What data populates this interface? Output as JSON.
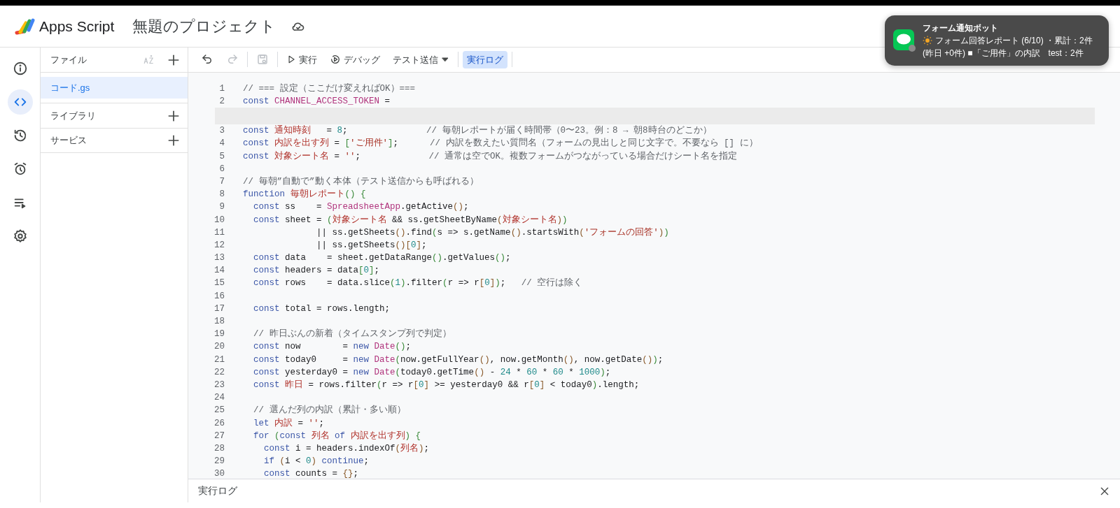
{
  "header": {
    "app_name": "Apps Script",
    "project_title": "無題のプロジェクト"
  },
  "rail": [
    {
      "kind": "info",
      "selected": false
    },
    {
      "kind": "code",
      "selected": true
    },
    {
      "kind": "history",
      "selected": false
    },
    {
      "kind": "alarm",
      "selected": false
    },
    {
      "kind": "executions",
      "selected": false
    },
    {
      "kind": "settings",
      "selected": false
    }
  ],
  "files_panel": {
    "title": "ファイル",
    "files": [
      {
        "name": "コード.gs",
        "selected": true
      }
    ],
    "sections": [
      {
        "title": "ライブラリ"
      },
      {
        "title": "サービス"
      }
    ]
  },
  "toolbar": {
    "undo": {
      "disabled": false
    },
    "redo": {
      "disabled": true
    },
    "save": {
      "disabled": true
    },
    "run": "実行",
    "debug": "デバッグ",
    "test_send": "テスト送信",
    "log_toggle": {
      "label": "実行ログ",
      "selected": true
    }
  },
  "editor": {
    "lines": [
      {
        "n": "1",
        "tokens": [
          {
            "kind": "comment",
            "text": "// === 設定（ここだけ変えればOK）==="
          }
        ]
      },
      {
        "n": "2",
        "redacted": true,
        "tokens": [
          {
            "kind": "keyword",
            "text": "const "
          },
          {
            "kind": "member",
            "text": "CHANNEL_ACCESS_TOKEN"
          },
          {
            "kind": "plain",
            "text": " ="
          }
        ]
      },
      {
        "n": "3",
        "tokens": [
          {
            "kind": "keyword",
            "text": "const "
          },
          {
            "kind": "variable",
            "text": "通知時刻"
          },
          {
            "kind": "plain",
            "text": "   = "
          },
          {
            "kind": "number",
            "text": "8"
          },
          {
            "kind": "plain",
            "text": ";"
          },
          {
            "kind": "comment",
            "text": "               // 毎朝レポートが届く時間帯（0〜23。例：8 → 朝8時台のどこか）"
          }
        ]
      },
      {
        "n": "4",
        "tokens": [
          {
            "kind": "keyword",
            "text": "const "
          },
          {
            "kind": "variable",
            "text": "内訳を出す列"
          },
          {
            "kind": "plain",
            "text": " = "
          },
          {
            "kind": "bracket",
            "text": "["
          },
          {
            "kind": "string",
            "text": "'ご用件'"
          },
          {
            "kind": "bracket",
            "text": "]"
          },
          {
            "kind": "plain",
            "text": ";"
          },
          {
            "kind": "comment",
            "text": "      // 内訳を数えたい質問名（フォームの見出しと同じ文字で。不要なら [] に）"
          }
        ]
      },
      {
        "n": "5",
        "tokens": [
          {
            "kind": "keyword",
            "text": "const "
          },
          {
            "kind": "variable",
            "text": "対象シート名"
          },
          {
            "kind": "plain",
            "text": " = "
          },
          {
            "kind": "string",
            "text": "''"
          },
          {
            "kind": "plain",
            "text": ";"
          },
          {
            "kind": "comment",
            "text": "             // 通常は空でOK。複数フォームがつながっている場合だけシート名を指定"
          }
        ]
      },
      {
        "n": "6"
      },
      {
        "n": "7",
        "tokens": [
          {
            "kind": "comment",
            "text": "// 毎朝”自動で”動く本体（テスト送信からも呼ばれる）"
          }
        ]
      },
      {
        "n": "8",
        "tokens": [
          {
            "kind": "keyword",
            "text": "function "
          },
          {
            "kind": "variable",
            "text": "毎朝レポート"
          },
          {
            "kind": "bracket",
            "text": "()"
          },
          {
            "kind": "bracket",
            "text": " {"
          }
        ]
      },
      {
        "n": "9",
        "tokens": [
          {
            "kind": "keyword",
            "text": "  const"
          },
          {
            "kind": "plain",
            "text": " ss    = "
          },
          {
            "kind": "member",
            "text": "SpreadsheetApp"
          },
          {
            "kind": "plain",
            "text": ".getActive"
          },
          {
            "kind": "paren",
            "text": "()"
          },
          {
            "kind": "plain",
            "text": ";"
          }
        ]
      },
      {
        "n": "10",
        "tokens": [
          {
            "kind": "keyword",
            "text": "  const"
          },
          {
            "kind": "plain",
            "text": " sheet = "
          },
          {
            "kind": "bracket",
            "text": "("
          },
          {
            "kind": "variable",
            "text": "対象シート名"
          },
          {
            "kind": "plain",
            "text": " && ss.getSheetByName"
          },
          {
            "kind": "paren",
            "text": "("
          },
          {
            "kind": "variable",
            "text": "対象シート名"
          },
          {
            "kind": "paren",
            "text": ")"
          },
          {
            "kind": "bracket",
            "text": ")"
          }
        ]
      },
      {
        "n": "11",
        "tokens": [
          {
            "kind": "plain",
            "text": "              || ss.getSheets"
          },
          {
            "kind": "paren",
            "text": "()"
          },
          {
            "kind": "plain",
            "text": ".find"
          },
          {
            "kind": "bracket",
            "text": "("
          },
          {
            "kind": "plain",
            "text": "s => s.getName"
          },
          {
            "kind": "paren",
            "text": "()"
          },
          {
            "kind": "plain",
            "text": ".startsWith"
          },
          {
            "kind": "paren",
            "text": "("
          },
          {
            "kind": "string",
            "text": "'フォームの回答'"
          },
          {
            "kind": "paren",
            "text": ")"
          },
          {
            "kind": "bracket",
            "text": ")"
          }
        ]
      },
      {
        "n": "12",
        "tokens": [
          {
            "kind": "plain",
            "text": "              || ss.getSheets"
          },
          {
            "kind": "paren",
            "text": "()"
          },
          {
            "kind": "paren",
            "text": "["
          },
          {
            "kind": "number",
            "text": "0"
          },
          {
            "kind": "paren",
            "text": "]"
          },
          {
            "kind": "plain",
            "text": ";"
          }
        ]
      },
      {
        "n": "13",
        "tokens": [
          {
            "kind": "keyword",
            "text": "  const"
          },
          {
            "kind": "plain",
            "text": " data    = sheet.getDataRange"
          },
          {
            "kind": "bracket",
            "text": "()"
          },
          {
            "kind": "plain",
            "text": ".getValues"
          },
          {
            "kind": "bracket",
            "text": "()"
          },
          {
            "kind": "plain",
            "text": ";"
          }
        ]
      },
      {
        "n": "14",
        "tokens": [
          {
            "kind": "keyword",
            "text": "  const"
          },
          {
            "kind": "plain",
            "text": " headers = data"
          },
          {
            "kind": "bracket",
            "text": "["
          },
          {
            "kind": "number",
            "text": "0"
          },
          {
            "kind": "bracket",
            "text": "]"
          },
          {
            "kind": "plain",
            "text": ";"
          }
        ]
      },
      {
        "n": "15",
        "tokens": [
          {
            "kind": "keyword",
            "text": "  const"
          },
          {
            "kind": "plain",
            "text": " rows    = data.slice"
          },
          {
            "kind": "bracket",
            "text": "("
          },
          {
            "kind": "number",
            "text": "1"
          },
          {
            "kind": "bracket",
            "text": ")"
          },
          {
            "kind": "plain",
            "text": ".filter"
          },
          {
            "kind": "bracket",
            "text": "("
          },
          {
            "kind": "plain",
            "text": "r => r"
          },
          {
            "kind": "paren",
            "text": "["
          },
          {
            "kind": "number",
            "text": "0"
          },
          {
            "kind": "paren",
            "text": "]"
          },
          {
            "kind": "bracket",
            "text": ")"
          },
          {
            "kind": "plain",
            "text": ";"
          },
          {
            "kind": "comment",
            "text": "   // 空行は除く"
          }
        ]
      },
      {
        "n": "16"
      },
      {
        "n": "17",
        "tokens": [
          {
            "kind": "keyword",
            "text": "  const"
          },
          {
            "kind": "plain",
            "text": " total = rows.length;"
          }
        ]
      },
      {
        "n": "18"
      },
      {
        "n": "19",
        "tokens": [
          {
            "kind": "comment",
            "text": "  // 昨日ぶんの新着（タイムスタンプ列で判定）"
          }
        ]
      },
      {
        "n": "20",
        "tokens": [
          {
            "kind": "keyword",
            "text": "  const"
          },
          {
            "kind": "plain",
            "text": " now        = "
          },
          {
            "kind": "keyword",
            "text": "new "
          },
          {
            "kind": "member",
            "text": "Date"
          },
          {
            "kind": "bracket",
            "text": "()"
          },
          {
            "kind": "plain",
            "text": ";"
          }
        ]
      },
      {
        "n": "21",
        "tokens": [
          {
            "kind": "keyword",
            "text": "  const"
          },
          {
            "kind": "plain",
            "text": " today0     = "
          },
          {
            "kind": "keyword",
            "text": "new "
          },
          {
            "kind": "member",
            "text": "Date"
          },
          {
            "kind": "bracket",
            "text": "("
          },
          {
            "kind": "plain",
            "text": "now.getFullYear"
          },
          {
            "kind": "paren",
            "text": "()"
          },
          {
            "kind": "plain",
            "text": ", now.getMonth"
          },
          {
            "kind": "paren",
            "text": "()"
          },
          {
            "kind": "plain",
            "text": ", now.getDate"
          },
          {
            "kind": "paren",
            "text": "()"
          },
          {
            "kind": "bracket",
            "text": ")"
          },
          {
            "kind": "plain",
            "text": ";"
          }
        ]
      },
      {
        "n": "22",
        "tokens": [
          {
            "kind": "keyword",
            "text": "  const"
          },
          {
            "kind": "plain",
            "text": " yesterday0 = "
          },
          {
            "kind": "keyword",
            "text": "new "
          },
          {
            "kind": "member",
            "text": "Date"
          },
          {
            "kind": "bracket",
            "text": "("
          },
          {
            "kind": "plain",
            "text": "today0.getTime"
          },
          {
            "kind": "paren",
            "text": "()"
          },
          {
            "kind": "plain",
            "text": " - "
          },
          {
            "kind": "number",
            "text": "24"
          },
          {
            "kind": "plain",
            "text": " * "
          },
          {
            "kind": "number",
            "text": "60"
          },
          {
            "kind": "plain",
            "text": " * "
          },
          {
            "kind": "number",
            "text": "60"
          },
          {
            "kind": "plain",
            "text": " * "
          },
          {
            "kind": "number",
            "text": "1000"
          },
          {
            "kind": "bracket",
            "text": ")"
          },
          {
            "kind": "plain",
            "text": ";"
          }
        ]
      },
      {
        "n": "23",
        "tokens": [
          {
            "kind": "keyword",
            "text": "  const "
          },
          {
            "kind": "variable",
            "text": "昨日"
          },
          {
            "kind": "plain",
            "text": " = rows.filter"
          },
          {
            "kind": "bracket",
            "text": "("
          },
          {
            "kind": "plain",
            "text": "r => r"
          },
          {
            "kind": "paren",
            "text": "["
          },
          {
            "kind": "number",
            "text": "0"
          },
          {
            "kind": "paren",
            "text": "]"
          },
          {
            "kind": "plain",
            "text": " >= yesterday0 && r"
          },
          {
            "kind": "paren",
            "text": "["
          },
          {
            "kind": "number",
            "text": "0"
          },
          {
            "kind": "paren",
            "text": "]"
          },
          {
            "kind": "plain",
            "text": " < today0"
          },
          {
            "kind": "bracket",
            "text": ")"
          },
          {
            "kind": "plain",
            "text": ".length;"
          }
        ]
      },
      {
        "n": "24"
      },
      {
        "n": "25",
        "tokens": [
          {
            "kind": "comment",
            "text": "  // 選んだ列の内訳（累計・多い順）"
          }
        ]
      },
      {
        "n": "26",
        "tokens": [
          {
            "kind": "keyword",
            "text": "  let "
          },
          {
            "kind": "variable",
            "text": "内訳"
          },
          {
            "kind": "plain",
            "text": " = "
          },
          {
            "kind": "string",
            "text": "''"
          },
          {
            "kind": "plain",
            "text": ";"
          }
        ]
      },
      {
        "n": "27",
        "tokens": [
          {
            "kind": "keyword",
            "text": "  for "
          },
          {
            "kind": "bracket",
            "text": "("
          },
          {
            "kind": "keyword",
            "text": "const "
          },
          {
            "kind": "variable",
            "text": "列名"
          },
          {
            "kind": "keyword",
            "text": " of "
          },
          {
            "kind": "variable",
            "text": "内訳を出す列"
          },
          {
            "kind": "bracket",
            "text": ")"
          },
          {
            "kind": "bracket",
            "text": " {"
          }
        ]
      },
      {
        "n": "28",
        "tokens": [
          {
            "kind": "keyword",
            "text": "    const"
          },
          {
            "kind": "plain",
            "text": " i = headers.indexOf"
          },
          {
            "kind": "paren",
            "text": "("
          },
          {
            "kind": "variable",
            "text": "列名"
          },
          {
            "kind": "paren",
            "text": ")"
          },
          {
            "kind": "plain",
            "text": ";"
          }
        ]
      },
      {
        "n": "29",
        "tokens": [
          {
            "kind": "keyword",
            "text": "    if "
          },
          {
            "kind": "paren",
            "text": "("
          },
          {
            "kind": "plain",
            "text": "i < "
          },
          {
            "kind": "number",
            "text": "0"
          },
          {
            "kind": "paren",
            "text": ")"
          },
          {
            "kind": "keyword",
            "text": " continue"
          },
          {
            "kind": "plain",
            "text": ";"
          }
        ]
      },
      {
        "n": "30",
        "tokens": [
          {
            "kind": "keyword",
            "text": "    const"
          },
          {
            "kind": "plain",
            "text": " counts = "
          },
          {
            "kind": "paren",
            "text": "{}"
          },
          {
            "kind": "plain",
            "text": ";"
          }
        ]
      }
    ]
  },
  "log_panel": {
    "title": "実行ログ"
  },
  "notification": {
    "title": "フォーム通知ボット",
    "lines": [
      "フォーム回答レポート (6/10) ・累計：2件",
      "(昨日 +0件) ■「ご用件」の内訳　test：2件"
    ]
  }
}
